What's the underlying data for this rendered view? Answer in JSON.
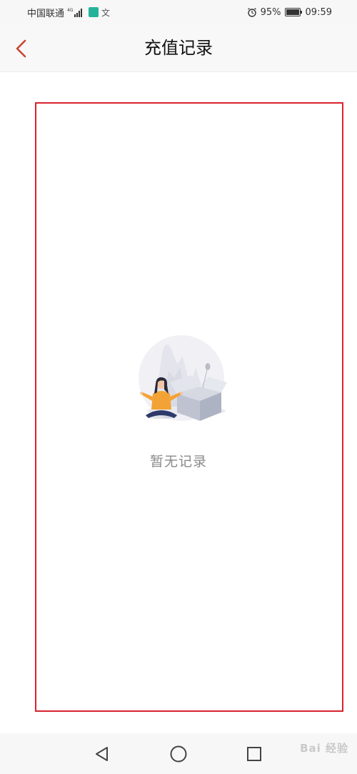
{
  "status_bar": {
    "carrier": "中国联通",
    "network_type": "4G",
    "app_icon_2": "文",
    "battery_percent": "95%",
    "time": "09:59",
    "icons": [
      "signal-icon",
      "app-icon",
      "language-icon",
      "alarm-icon",
      "battery-icon"
    ]
  },
  "header": {
    "title": "充值记录",
    "back_icon": "chevron-left-icon",
    "accent_color": "#c8452f"
  },
  "empty_state": {
    "message": "暂无记录",
    "illustration": "empty-box-illustration"
  },
  "system_nav": {
    "buttons": [
      "back-triangle-icon",
      "home-circle-icon",
      "recents-square-icon"
    ]
  },
  "watermark": {
    "text": "Bai 经验"
  },
  "colors": {
    "highlight_border": "#d8232e",
    "empty_text": "#8a8a8a",
    "bar_background": "#f8f8f8"
  }
}
